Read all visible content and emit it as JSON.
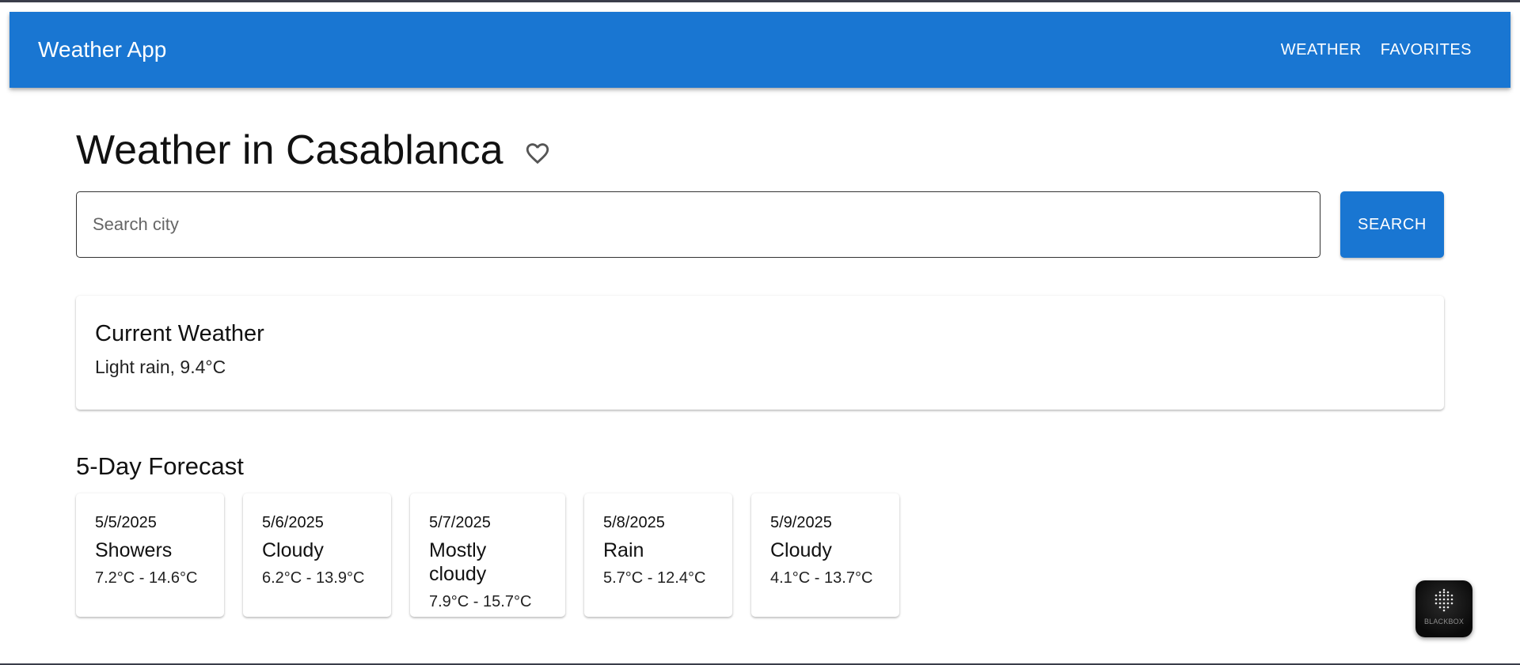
{
  "app": {
    "title": "Weather App",
    "nav": [
      "WEATHER",
      "FAVORITES"
    ]
  },
  "page": {
    "title": "Weather in Casablanca",
    "favorite_icon": "heart-outline-icon"
  },
  "search": {
    "placeholder": "Search city",
    "value": "",
    "button_label": "SEARCH"
  },
  "current": {
    "title": "Current Weather",
    "description": "Light rain, 9.4°C"
  },
  "forecast": {
    "title": "5-Day Forecast",
    "days": [
      {
        "date": "5/5/2025",
        "condition": "Showers",
        "range": "7.2°C - 14.6°C"
      },
      {
        "date": "5/6/2025",
        "condition": "Cloudy",
        "range": "6.2°C - 13.9°C"
      },
      {
        "date": "5/7/2025",
        "condition": "Mostly cloudy",
        "range": "7.9°C - 15.7°C"
      },
      {
        "date": "5/8/2025",
        "condition": "Rain",
        "range": "5.7°C - 12.4°C"
      },
      {
        "date": "5/9/2025",
        "condition": "Cloudy",
        "range": "4.1°C - 13.7°C"
      }
    ]
  },
  "widget": {
    "label": "BLACKBOX"
  },
  "colors": {
    "primary": "#1976d2",
    "text": "#111111"
  }
}
